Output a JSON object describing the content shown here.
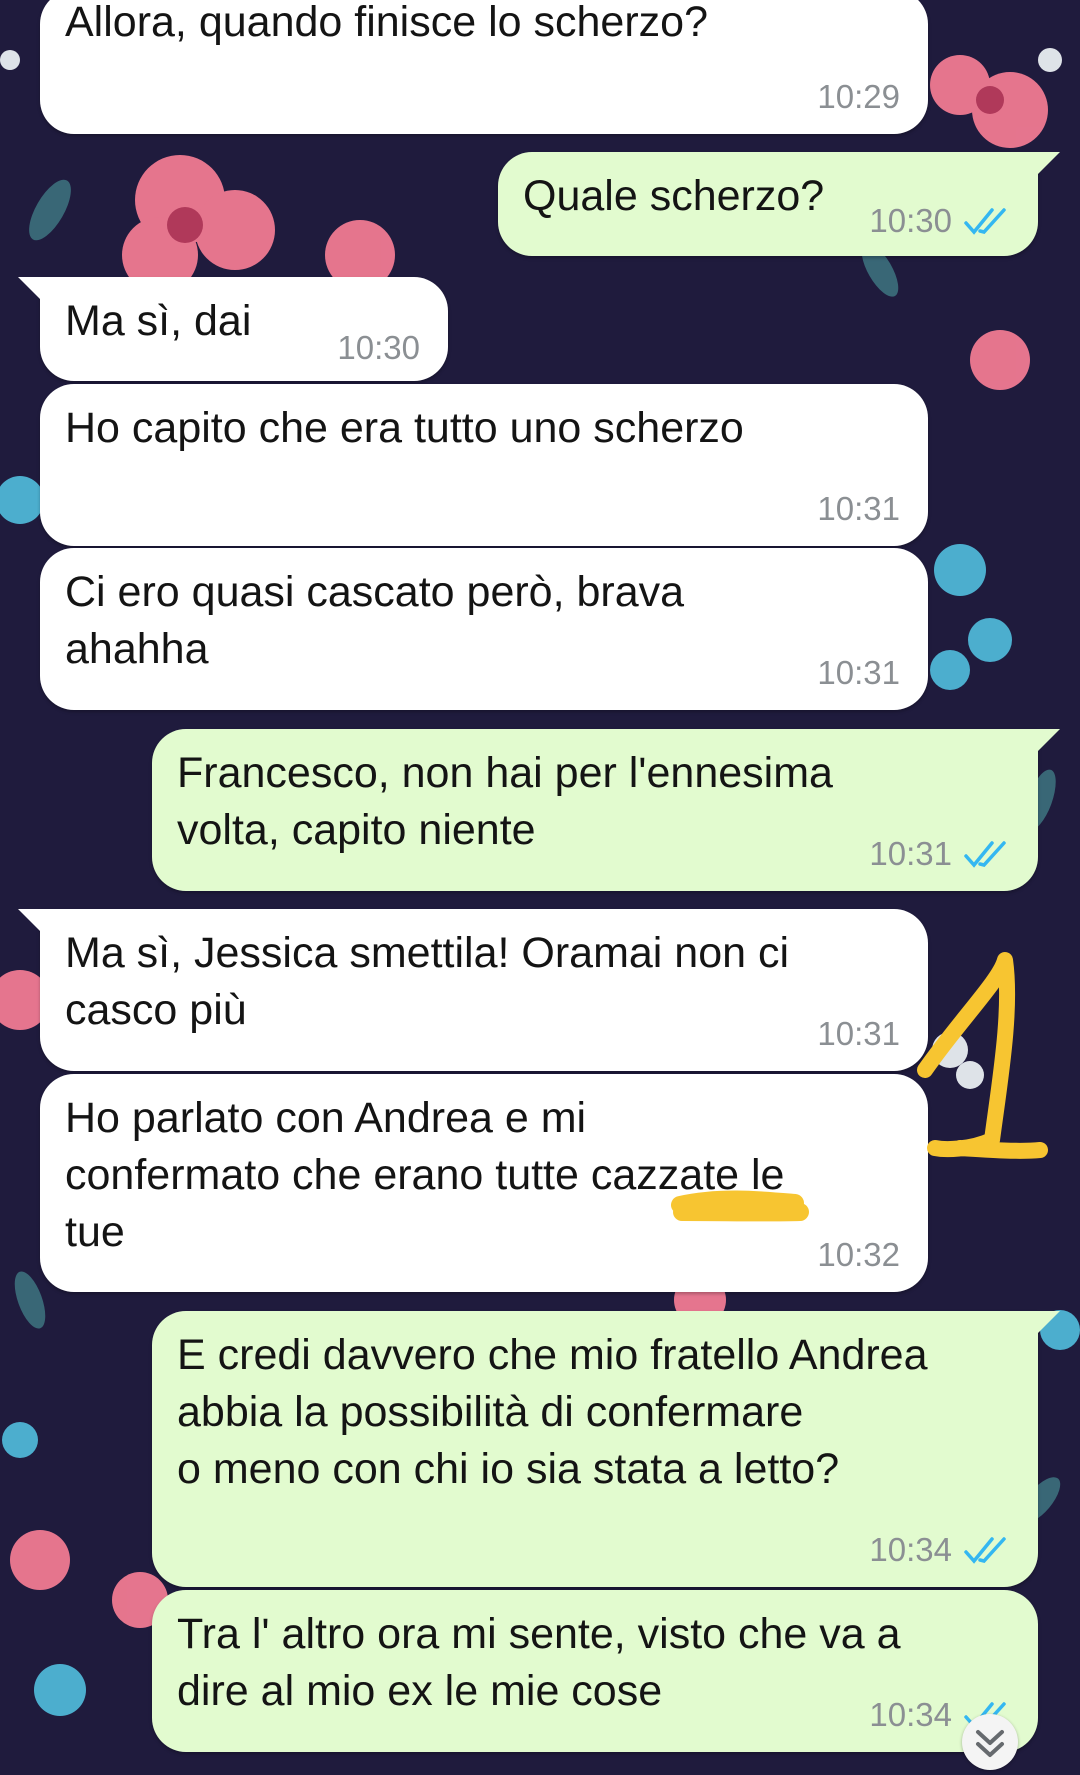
{
  "conversation": {
    "messages": [
      {
        "direction": "in",
        "text": "Allora, quando finisce lo scherzo?",
        "time": "10:29",
        "ticks": false
      },
      {
        "direction": "out",
        "text": "Quale scherzo?",
        "time": "10:30",
        "ticks": true
      },
      {
        "direction": "in",
        "text": "Ma sì, dai",
        "time": "10:30",
        "ticks": false
      },
      {
        "direction": "in",
        "text": "Ho capito che era tutto uno scherzo",
        "time": "10:31",
        "ticks": false
      },
      {
        "direction": "in",
        "text": "Ci ero quasi cascato però, brava\nahahha",
        "time": "10:31",
        "ticks": false
      },
      {
        "direction": "out",
        "text": "Francesco, non hai per l'ennesima\nvolta, capito niente",
        "time": "10:31",
        "ticks": true
      },
      {
        "direction": "in",
        "text": "Ma sì, Jessica smettila! Oramai non ci\ncasco più",
        "time": "10:31",
        "ticks": false
      },
      {
        "direction": "in",
        "text": "Ho parlato con Andrea e mi\nconfermato che erano tutte cazzate le\ntue",
        "time": "10:32",
        "ticks": false
      },
      {
        "direction": "out",
        "text": "E credi davvero che mio fratello Andrea\nabbia la possibilità di confermare\no meno con chi io sia stata a letto?",
        "time": "10:34",
        "ticks": true
      },
      {
        "direction": "out",
        "text": "Tra l' altro ora mi sente, visto che va a\ndire al mio ex le mie cose",
        "time": "10:34",
        "ticks": true
      }
    ]
  },
  "annotation": {
    "label": "1",
    "color": "#f7c531"
  },
  "colors": {
    "incoming": "#ffffff",
    "outgoing": "#e2fbcf",
    "read_ticks": "#34b7f1",
    "timestamp": "#8b8f93"
  },
  "icons": {
    "read_receipt": "double-check-icon",
    "scroll": "chevron-double-down-icon"
  }
}
